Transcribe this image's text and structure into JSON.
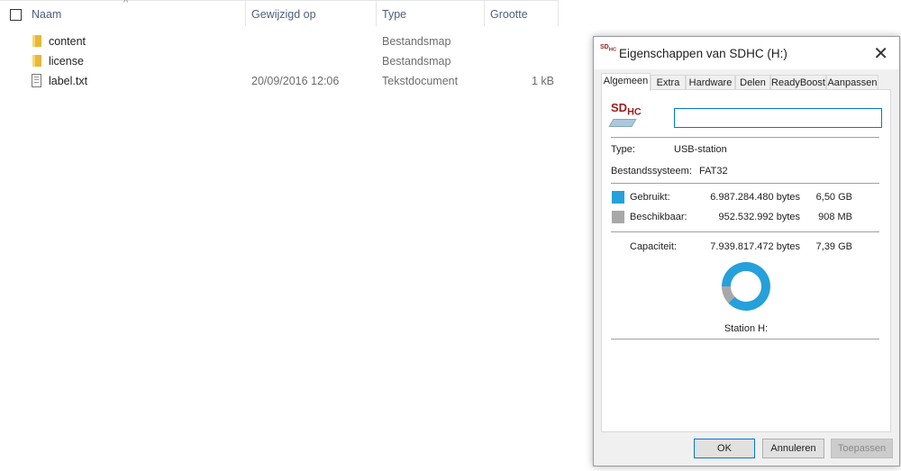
{
  "explorer": {
    "columns": [
      "Naam",
      "Gewijzigd op",
      "Type",
      "Grootte"
    ],
    "rows": [
      {
        "name": "content",
        "modified": "",
        "type": "Bestandsmap",
        "size": "",
        "icon": "folder-icon"
      },
      {
        "name": "license",
        "modified": "",
        "type": "Bestandsmap",
        "size": "",
        "icon": "folder-icon"
      },
      {
        "name": "label.txt",
        "modified": "20/09/2016 12:06",
        "type": "Tekstdocument",
        "size": "1 kB",
        "icon": "text-file-icon"
      }
    ]
  },
  "dialog": {
    "title": "Eigenschappen van SDHC (H:)",
    "logo_text": "SDHC",
    "tabs": [
      "Algemeen",
      "Extra",
      "Hardware",
      "Delen",
      "ReadyBoost",
      "Aanpassen"
    ],
    "name_value": "",
    "type_label": "Type:",
    "type_value": "USB-station",
    "fs_label": "Bestandssysteem:",
    "fs_value": "FAT32",
    "used_label": "Gebruikt:",
    "used_bytes": "6.987.284.480 bytes",
    "used_size": "6,50 GB",
    "free_label": "Beschikbaar:",
    "free_bytes": "952.532.992 bytes",
    "free_size": "908 MB",
    "cap_label": "Capaciteit:",
    "cap_bytes": "7.939.817.472 bytes",
    "cap_size": "7,39 GB",
    "station": "Station H:",
    "used_fraction": 0.88,
    "colors": {
      "used": "#26a0da",
      "free": "#a8a8a8"
    },
    "buttons": {
      "ok": "OK",
      "cancel": "Annuleren",
      "apply": "Toepassen"
    }
  }
}
